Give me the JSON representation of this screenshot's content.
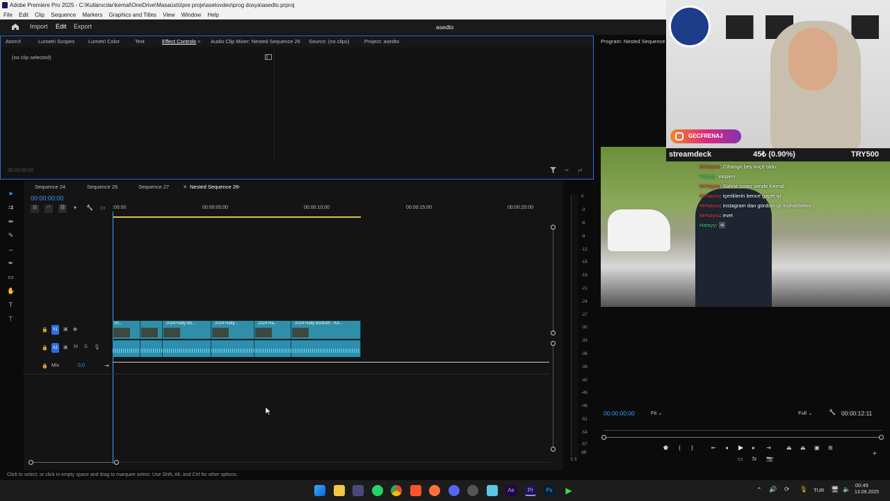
{
  "window": {
    "title": "Adobe Premiere Pro 2025 - C:\\Kullanıcılar\\kemal\\OneDrive\\Masaüstü\\pre proje\\asetovdeo\\prog dosya\\asedto.prproj"
  },
  "menu": [
    "File",
    "Edit",
    "Clip",
    "Sequence",
    "Markers",
    "Graphics and Titles",
    "View",
    "Window",
    "Help"
  ],
  "header": {
    "import": "Import",
    "edit": "Edit",
    "export": "Export",
    "project_title": "asedto"
  },
  "top_tabs": [
    "AtomX",
    "Lumetri Scopes",
    "Lumetri Color",
    "Text",
    "Effect Controls",
    "Audio Clip Mixer: Nested Sequence 26",
    "Source: (no clips)",
    "Project: asedto"
  ],
  "effect_controls": {
    "no_clip": "(no clip selected)",
    "timecode": "00:00:00:00"
  },
  "timeline": {
    "tabs": [
      "Sequence 24",
      "Sequence 26",
      "Sequence 27",
      "Nested Sequence 26"
    ],
    "timecode": "00:00:00:00",
    "ruler": [
      ":00:00",
      "00:00:05:00",
      "00:00:10:00",
      "00:00:15:00",
      "00:00:20:00"
    ],
    "tracks": {
      "v1": "V1",
      "a1": "A1",
      "mix": "Mix",
      "mix_value": "0,0",
      "m": "M",
      "s": "S"
    },
    "clips": [
      "20...",
      "2024 Rally Bo...",
      "2024 Rally...",
      "2024 Ra...",
      "2024 Rally Bodrum - Ke..."
    ]
  },
  "meter_scale": [
    "0",
    "-3",
    "-6",
    "-9",
    "-12",
    "-15",
    "-18",
    "-21",
    "-24",
    "-27",
    "-30",
    "-33",
    "-36",
    "-39",
    "-42",
    "-45",
    "-48",
    "-51",
    "-54",
    "-57",
    "dB"
  ],
  "meter_footer": "S S",
  "program": {
    "tab": "Program: Nested Sequence 26",
    "timecode": "00:00:00:00",
    "fit": "Fit",
    "quality": "Full",
    "duration": "00:00:12:11"
  },
  "stream": {
    "instagram": "GECFRENAJ",
    "ticker_name": "streamdeck",
    "ticker_value": "45₺ (0.90%)",
    "ticker_right": "TRY500",
    "chat": [
      {
        "user": "MrNayss",
        "msg": "Cihangir bey koçe oldu"
      },
      {
        "user": "Hatayy",
        "msg": "ekipleri"
      },
      {
        "user": "MrNayss",
        "msg": "Sahne sırası sende Kemal"
      },
      {
        "user": "MrNayss",
        "msg": "içeriklerin bence gayet iyi"
      },
      {
        "user": "MrNayss",
        "msg": "instagram dan gördüm gt muhabbetini"
      },
      {
        "user": "MrNayss",
        "msg": "evet"
      },
      {
        "user": "Hatayy",
        "msg": "🖼"
      }
    ]
  },
  "status": "Click to select, or click in empty space and drag to marquee select. Use Shift, Alt, and Ctrl for other options.",
  "taskbar": {
    "lang": "TUR",
    "time": "00:49",
    "date": "13.09.2025"
  },
  "colors": {
    "accent": "#3e9bff",
    "clip_video": "#2f8fa8",
    "clip_audio": "#2c8fb0",
    "workarea": "#d8c64a",
    "panel_border": "#2d6fe0"
  }
}
